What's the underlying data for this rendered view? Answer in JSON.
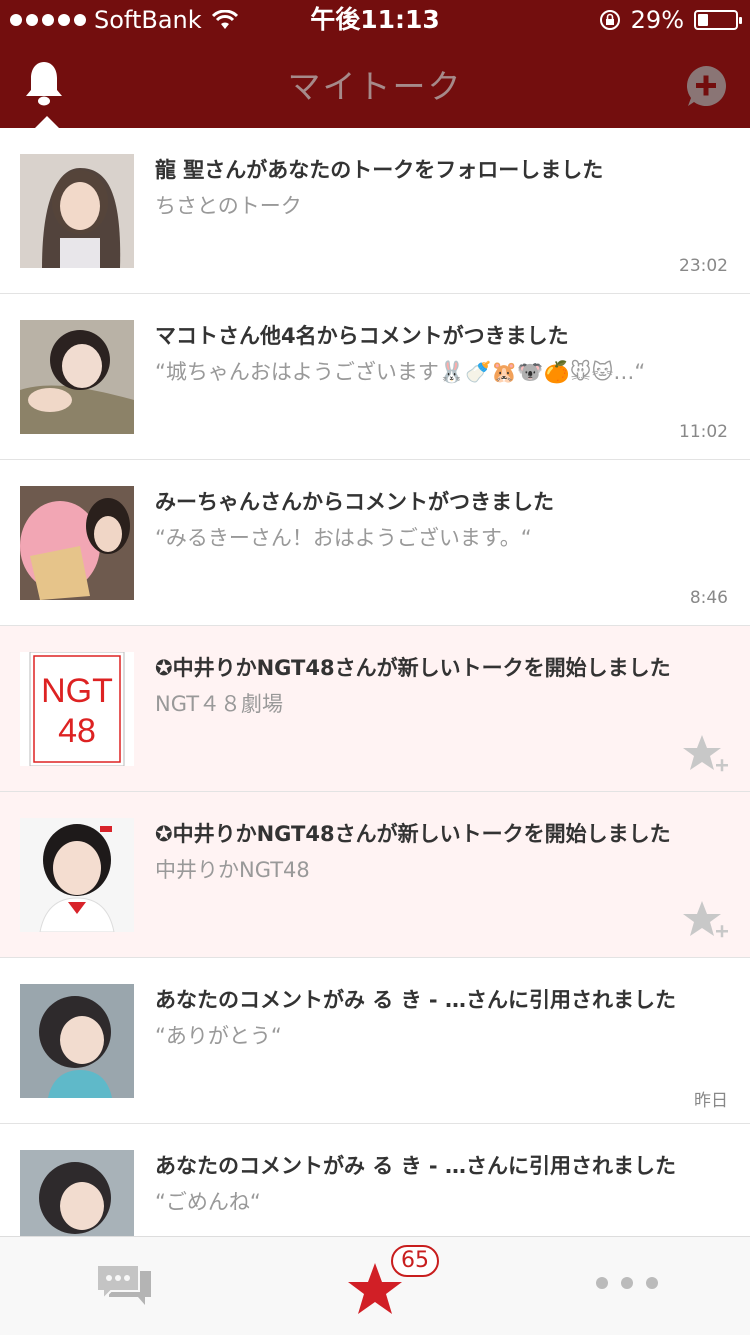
{
  "status": {
    "carrier": "SoftBank",
    "time": "午後11:13",
    "battery": "29%",
    "battery_level": 0.29
  },
  "nav": {
    "title": "マイトーク"
  },
  "items": [
    {
      "title": "龍 聖さんがあなたのトークをフォローしました",
      "subtitle": "ちさとのトーク",
      "time": "23:02",
      "pinned": false
    },
    {
      "title": "マコトさん他4名からコメントがつきました",
      "subtitle": "“城ちゃんおはようございます🐰🍼🐹🐨🍊🐭🐱…“",
      "time": "11:02",
      "pinned": false
    },
    {
      "title": "みーちゃんさんからコメントがつきました",
      "subtitle": "“みるきーさん！おはようございます。“",
      "time": "8:46",
      "pinned": false
    },
    {
      "title": "✪中井りかNGT48さんが新しいトークを開始しました",
      "subtitle": "NGT４８劇場",
      "thumb_text": "NGT48",
      "time": "",
      "pinned": true
    },
    {
      "title": "✪中井りかNGT48さんが新しいトークを開始しました",
      "subtitle": "中井りかNGT48",
      "time": "",
      "pinned": true
    },
    {
      "title": "あなたのコメントがみ る き -  …さんに引用されました",
      "subtitle": "“ありがとう“",
      "time": "昨日",
      "pinned": false
    },
    {
      "title": "あなたのコメントがみ る き -  …さんに引用されました",
      "subtitle": "“ごめんね“",
      "time": "",
      "pinned": false
    }
  ],
  "tabbar": {
    "badge": "65"
  },
  "colors": {
    "header": "#730e0e",
    "accent": "#c81e1e",
    "pinned_bg": "#fff3f3"
  },
  "icons": {
    "bell": "bell-icon",
    "add": "add-talk-icon",
    "talk": "talk-bubbles-icon",
    "fav": "star-icon",
    "more": "more-dots-icon",
    "star_add": "star-add-icon"
  }
}
